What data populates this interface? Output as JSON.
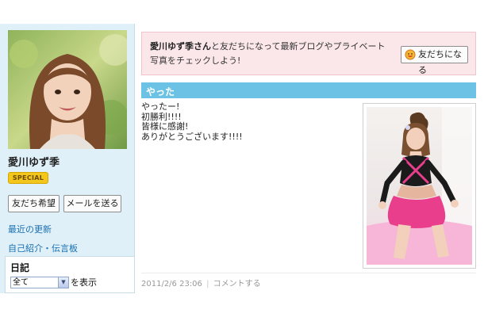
{
  "profile": {
    "name": "愛川ゆず季",
    "badge": "SPECIAL",
    "buttons": {
      "friend_request": "友だち希望",
      "send_mail": "メールを送る"
    },
    "links": {
      "recent_updates": "最近の更新",
      "self_intro": "自己紹介・伝言板"
    }
  },
  "diary": {
    "title": "日記",
    "filter_value": "全て",
    "filter_suffix": "を表示"
  },
  "invite": {
    "name": "愛川ゆず季さん",
    "message": "と友だちになって最新ブログやプライベート写真をチェックしよう!",
    "button_label": "友だちになる"
  },
  "entry": {
    "title": "やった",
    "lines": [
      "やったー!",
      "初勝利!!!!",
      "皆様に感謝!",
      "ありがとうございます!!!!"
    ],
    "date": "2011/2/6 23:06",
    "separator": "|",
    "comment_link": "コメントする"
  },
  "colors": {
    "sidebar_bg": "#dff0f9",
    "title_bar": "#6cc2e4",
    "invite_bg": "#fbe7ea",
    "badge": "#f3c61c",
    "link": "#1a6fb0"
  }
}
